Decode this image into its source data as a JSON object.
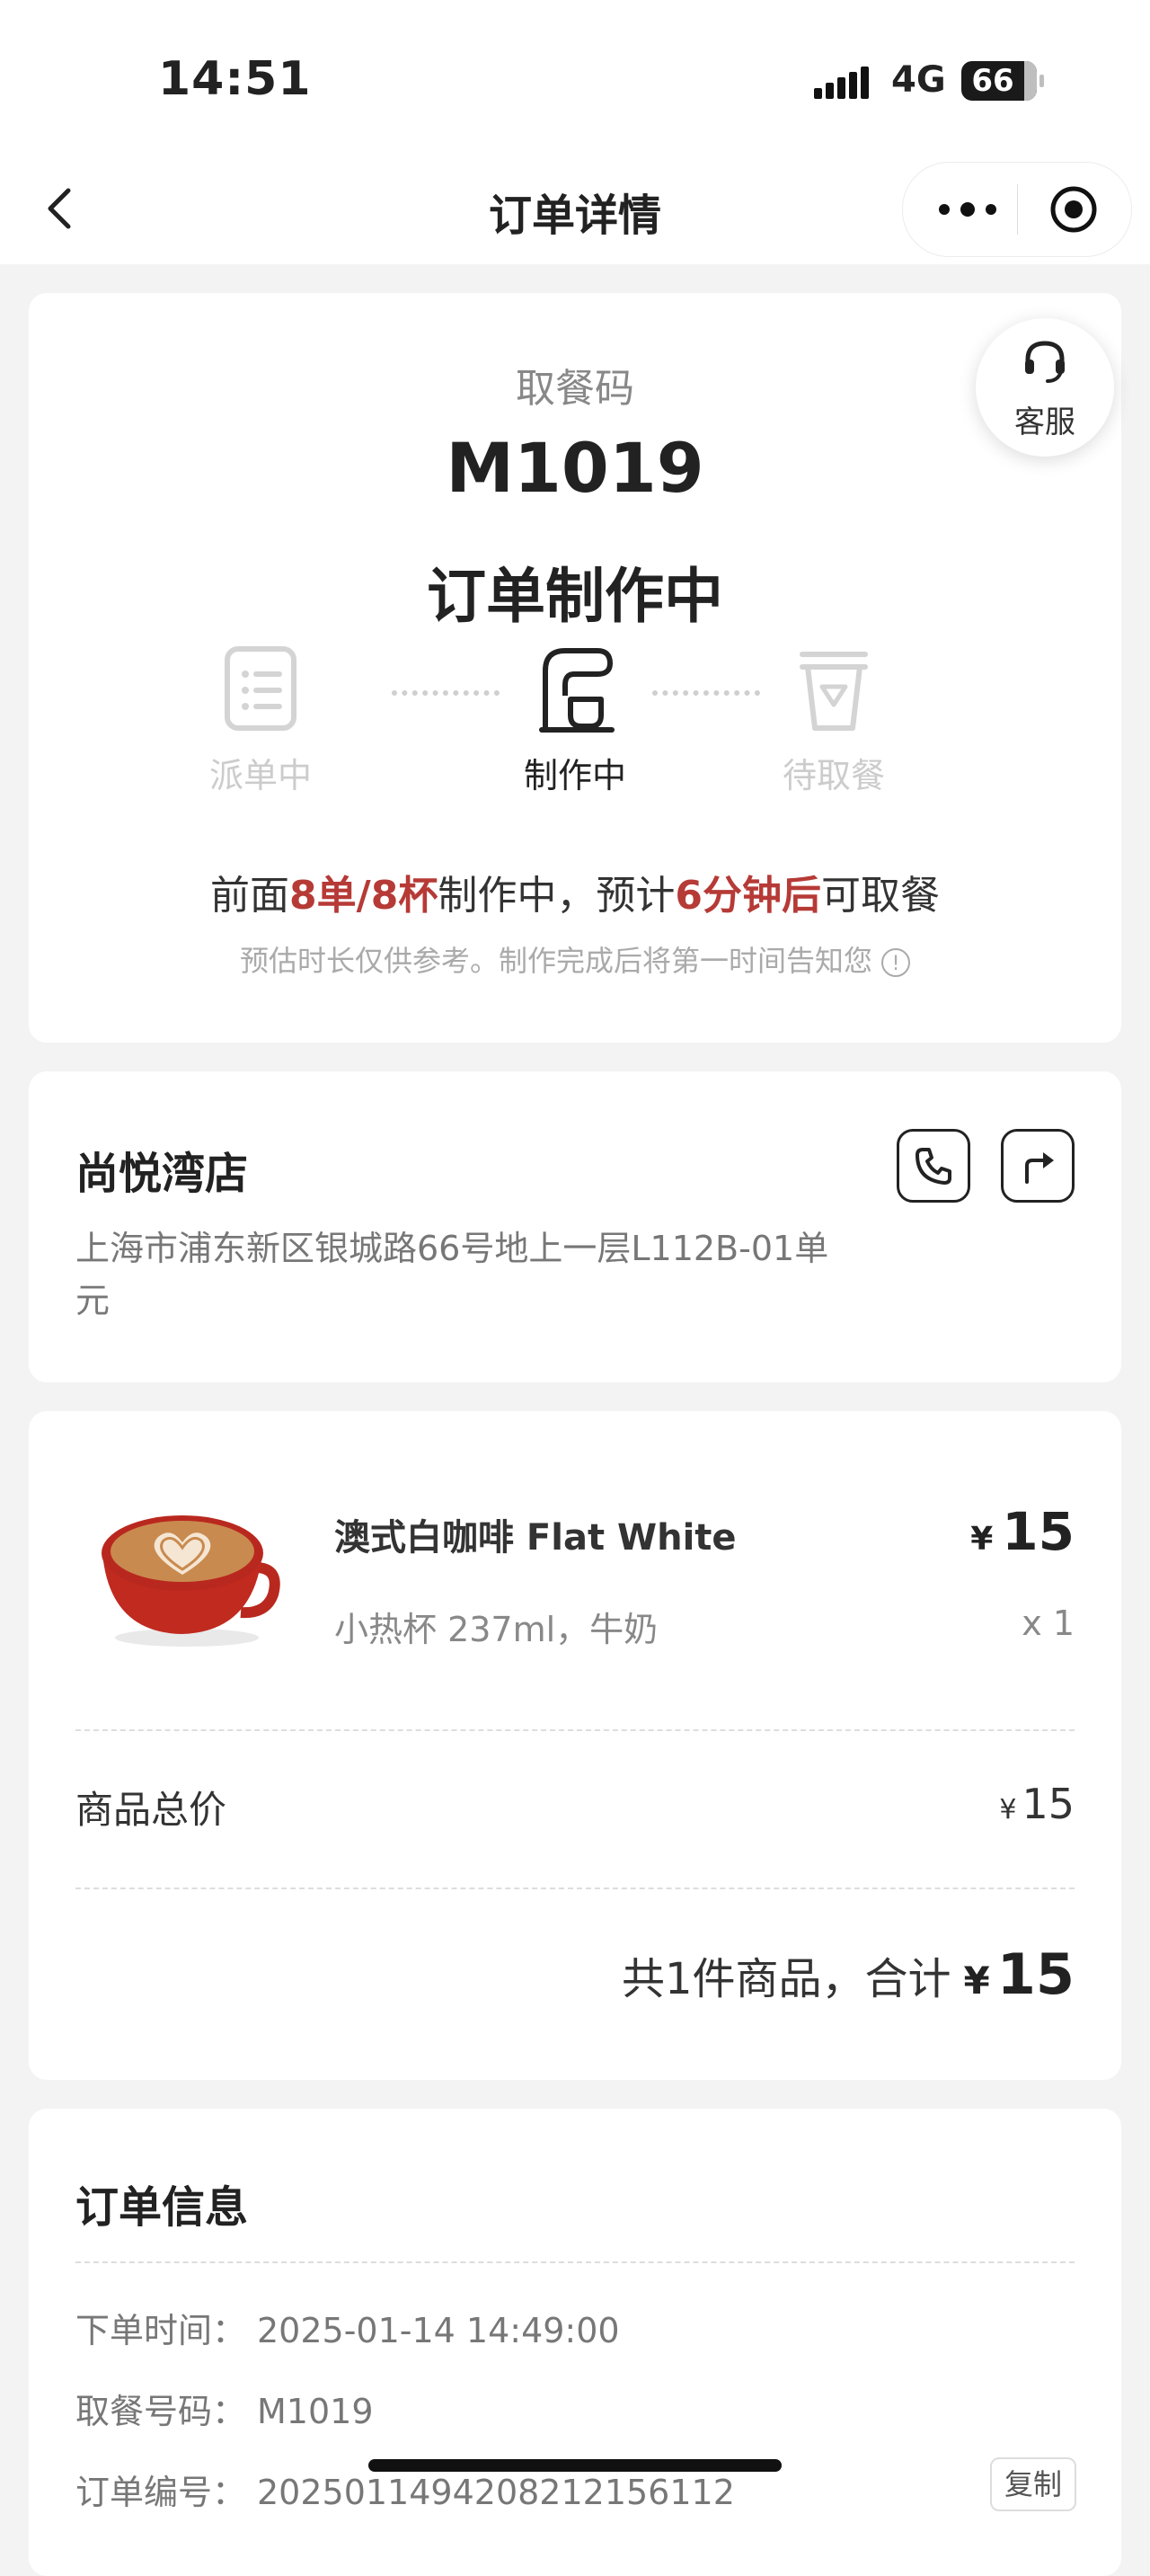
{
  "status_bar": {
    "time": "14:51",
    "network": "4G",
    "battery": "66"
  },
  "nav": {
    "title": "订单详情"
  },
  "pickup": {
    "service_label": "客服",
    "code_label": "取餐码",
    "code": "M1019",
    "status_title": "订单制作中",
    "steps": [
      "派单中",
      "制作中",
      "待取餐"
    ],
    "active_step": 1,
    "wait": {
      "prefix": "前面",
      "queue": "8单/8杯",
      "middle": "制作中，预计",
      "eta": "6分钟后",
      "suffix": "可取餐"
    },
    "note": "预估时长仅供参考。制作完成后将第一时间告知您"
  },
  "store": {
    "name": "尚悦湾店",
    "address": "上海市浦东新区银城路66号地上一层L112B-01单元"
  },
  "order": {
    "currency": "¥",
    "item": {
      "name": "澳式白咖啡 Flat White",
      "options": "小热杯 237ml，牛奶",
      "price": "15",
      "qty": "x 1"
    },
    "subtotal_label": "商品总价",
    "subtotal": "15",
    "summary_label": "共1件商品，合计",
    "total": "15"
  },
  "info": {
    "title": "订单信息",
    "rows": [
      {
        "key": "下单时间：",
        "value": "2025-01-14 14:49:00"
      },
      {
        "key": "取餐号码：",
        "value": "M1019"
      },
      {
        "key": "订单编号：",
        "value": "20250114942082121561​12"
      }
    ],
    "copy_label": "复制"
  }
}
